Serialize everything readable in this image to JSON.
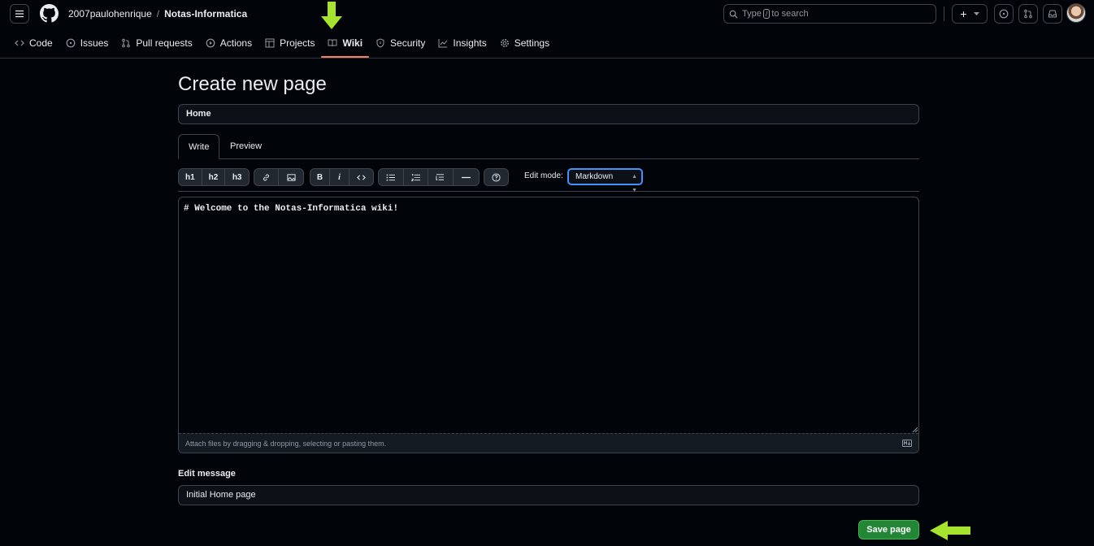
{
  "header": {
    "owner": "2007paulohenrique",
    "separator": "/",
    "repo": "Notas-Informatica",
    "search_prefix": "Type",
    "search_key": "/",
    "search_suffix": "to search",
    "new_label": "+"
  },
  "nav": {
    "items": [
      {
        "label": "Code",
        "icon": "code-icon"
      },
      {
        "label": "Issues",
        "icon": "issue-icon"
      },
      {
        "label": "Pull requests",
        "icon": "pull-request-icon"
      },
      {
        "label": "Actions",
        "icon": "play-icon"
      },
      {
        "label": "Projects",
        "icon": "table-icon"
      },
      {
        "label": "Wiki",
        "icon": "book-icon",
        "active": true
      },
      {
        "label": "Security",
        "icon": "shield-icon"
      },
      {
        "label": "Insights",
        "icon": "graph-icon"
      },
      {
        "label": "Settings",
        "icon": "gear-icon"
      }
    ]
  },
  "page": {
    "title": "Create new page",
    "page_name_value": "Home",
    "tabs": [
      "Write",
      "Preview"
    ],
    "toolbar": {
      "h1": "h1",
      "h2": "h2",
      "h3": "h3",
      "bold": "B",
      "italic": "i"
    },
    "edit_mode_label": "Edit mode:",
    "edit_mode_value": "Markdown",
    "editor_content": "# Welcome to the Notas-Informatica wiki!",
    "attach_hint": "Attach files by dragging & dropping, selecting or pasting them.",
    "edit_message_label": "Edit message",
    "edit_message_value": "Initial Home page",
    "save_label": "Save page"
  },
  "colors": {
    "background": "#010409",
    "accent_underline": "#f78166",
    "save_button": "#238636",
    "annotation_arrow": "#a6e22e",
    "focus_border": "#4493f8"
  }
}
